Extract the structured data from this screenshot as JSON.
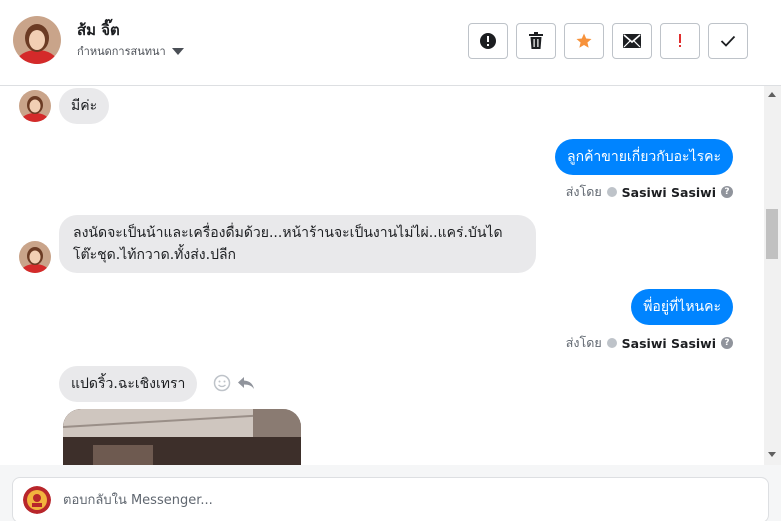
{
  "header": {
    "contact_name": "ส้ม จิ๊ต",
    "assign_label": "กำหนดการสนทนา",
    "actions": [
      {
        "name": "spam-button",
        "icon": "alert-circle-icon"
      },
      {
        "name": "delete-button",
        "icon": "trash-icon"
      },
      {
        "name": "star-button",
        "icon": "star-icon"
      },
      {
        "name": "mark-unread-button",
        "icon": "envelope-icon"
      },
      {
        "name": "follow-up-button",
        "icon": "exclamation-icon"
      },
      {
        "name": "mark-done-button",
        "icon": "checkmark-icon"
      }
    ]
  },
  "messages": {
    "m1": "มีค่ะ",
    "m2": "ลูกค้าขายเกี่ยวกับอะไรคะ",
    "m2_sent_prefix": "ส่งโดย",
    "m2_sender": "Sasiwi Sasiwi",
    "m3": "ลงนัดจะเป็นน้าและเครื่องดื่มด้วย...หน้าร้านจะเป็นงานไม่ไผ่..แคร่.บันไดโต๊ะชุด.ไท้กวาด.ทั้งส่ง.ปลีก",
    "m4": "พี่อยู่ที่ไหนคะ",
    "m4_sent_prefix": "ส่งโดย",
    "m4_sender": "Sasiwi Sasiwi",
    "m5": "แปดริ้ว.ฉะเชิงเทรา"
  },
  "composer": {
    "placeholder": "ตอบกลับใน Messenger..."
  },
  "colors": {
    "accent_blue": "#0084ff",
    "star_orange": "#f7923b",
    "follow_up_red": "#e02e2e",
    "incoming_bubble": "#e9e9eb"
  }
}
